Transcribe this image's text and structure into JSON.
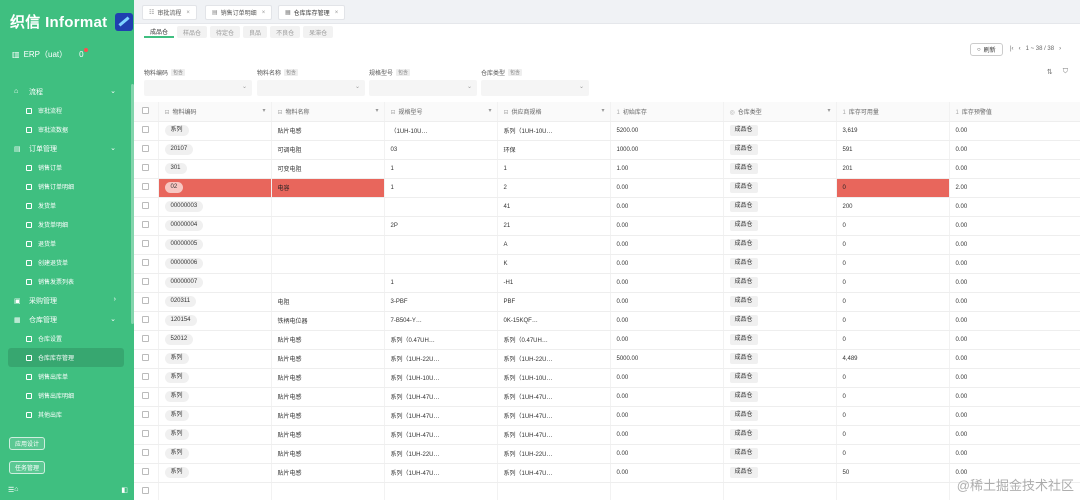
{
  "sidebar": {
    "brand": "织信 Informat",
    "app": "ERP（uat）",
    "notify_count": "0",
    "menu": [
      {
        "type": "group",
        "label": "流程",
        "icon": "⌂",
        "chevron": "⌄"
      },
      {
        "type": "item",
        "label": "审批流程"
      },
      {
        "type": "item",
        "label": "审批流数据"
      },
      {
        "type": "group",
        "label": "订单管理",
        "icon": "▤",
        "chevron": "⌄"
      },
      {
        "type": "item",
        "label": "销售订单"
      },
      {
        "type": "item",
        "label": "销售订单明细"
      },
      {
        "type": "item",
        "label": "发货单"
      },
      {
        "type": "item",
        "label": "发货单明细"
      },
      {
        "type": "item",
        "label": "退货单"
      },
      {
        "type": "item",
        "label": "创建退货单"
      },
      {
        "type": "item",
        "label": "销售发票列表"
      },
      {
        "type": "group",
        "label": "采购管理",
        "icon": "▣",
        "chevron": "›"
      },
      {
        "type": "group",
        "label": "仓库管理",
        "icon": "▦",
        "chevron": "⌄"
      },
      {
        "type": "item",
        "label": "仓库设置"
      },
      {
        "type": "item",
        "label": "仓库库存管理",
        "active": true
      },
      {
        "type": "item",
        "label": "销售出库单"
      },
      {
        "type": "item",
        "label": "销售出库明细"
      },
      {
        "type": "item",
        "label": "其他出库"
      }
    ],
    "btn_app_design": "应用设计",
    "btn_task_mgmt": "任务管理"
  },
  "top_tabs": [
    {
      "label": "审批流程",
      "icon": "☷"
    },
    {
      "label": "销售订单明细",
      "icon": "▤"
    },
    {
      "label": "仓库库存管理",
      "icon": "▦",
      "active": true
    }
  ],
  "sub_tabs": [
    {
      "label": "成品仓",
      "active": true
    },
    {
      "label": "样品仓"
    },
    {
      "label": "待定仓"
    },
    {
      "label": "良品"
    },
    {
      "label": "不良仓"
    },
    {
      "label": "呆滞仓"
    }
  ],
  "toolbar": {
    "refresh": "刷新",
    "pager_text": "1 ~ 38 / 38"
  },
  "filters": [
    {
      "label": "物料编码",
      "tag": "包含"
    },
    {
      "label": "物料名称",
      "tag": "包含"
    },
    {
      "label": "规格型号",
      "tag": "包含"
    },
    {
      "label": "仓库类型",
      "tag": "包含"
    }
  ],
  "columns": [
    "物料编码",
    "物料名称",
    "规格型号",
    "供应商规格",
    "初始库存",
    "仓库类型",
    "库存可用量",
    "库存预警值"
  ],
  "rows": [
    {
      "code": "系列",
      "name": "贴片电感",
      "spec": "（1UH-10U…",
      "supplier": "系列（1UH-10U…",
      "init": "5200.00",
      "type": "成品仓",
      "avail": "3,619",
      "warn": "0.00"
    },
    {
      "code": "20107",
      "name": "可调电阻",
      "spec": "03",
      "supplier": "环保",
      "init": "1000.00",
      "type": "成品仓",
      "avail": "591",
      "warn": "0.00"
    },
    {
      "code": "301",
      "name": "可变电阻",
      "spec": "1",
      "supplier": "1",
      "init": "1.00",
      "type": "成品仓",
      "avail": "201",
      "warn": "0.00"
    },
    {
      "code": "02",
      "name": "电容",
      "spec": "1",
      "supplier": "2",
      "init": "0.00",
      "type": "成品仓",
      "avail": "0",
      "warn": "2.00",
      "highlight": true
    },
    {
      "code": "00000003",
      "name": "",
      "spec": "",
      "supplier": "41",
      "init": "0.00",
      "type": "成品仓",
      "avail": "200",
      "warn": "0.00"
    },
    {
      "code": "00000004",
      "name": "",
      "spec": "2P",
      "supplier": "21",
      "init": "0.00",
      "type": "成品仓",
      "avail": "0",
      "warn": "0.00"
    },
    {
      "code": "00000005",
      "name": "",
      "spec": "",
      "supplier": "A",
      "init": "0.00",
      "type": "成品仓",
      "avail": "0",
      "warn": "0.00"
    },
    {
      "code": "00000006",
      "name": "",
      "spec": "",
      "supplier": "K",
      "init": "0.00",
      "type": "成品仓",
      "avail": "0",
      "warn": "0.00"
    },
    {
      "code": "00000007",
      "name": "",
      "spec": "1",
      "supplier": "-H1",
      "init": "0.00",
      "type": "成品仓",
      "avail": "0",
      "warn": "0.00"
    },
    {
      "code": "020311",
      "name": "电阻",
      "spec": "3-PBF",
      "supplier": "PBF",
      "init": "0.00",
      "type": "成品仓",
      "avail": "0",
      "warn": "0.00"
    },
    {
      "code": "120154",
      "name": "铁柄电位器",
      "spec": "7-B504-Y…",
      "supplier": "0K-15KQF…",
      "init": "0.00",
      "type": "成品仓",
      "avail": "0",
      "warn": "0.00"
    },
    {
      "code": "52012",
      "name": "贴片电感",
      "spec": "系列（0.47UH…",
      "supplier": "系列（0.47UH…",
      "init": "0.00",
      "type": "成品仓",
      "avail": "0",
      "warn": "0.00"
    },
    {
      "code": "系列",
      "name": "贴片电感",
      "spec": "系列（1UH-22U…",
      "supplier": "系列（1UH-22U…",
      "init": "5000.00",
      "type": "成品仓",
      "avail": "4,489",
      "warn": "0.00"
    },
    {
      "code": "系列",
      "name": "贴片电感",
      "spec": "系列（1UH-10U…",
      "supplier": "系列（1UH-10U…",
      "init": "0.00",
      "type": "成品仓",
      "avail": "0",
      "warn": "0.00"
    },
    {
      "code": "系列",
      "name": "贴片电感",
      "spec": "系列（1UH-47U…",
      "supplier": "系列（1UH-47U…",
      "init": "0.00",
      "type": "成品仓",
      "avail": "0",
      "warn": "0.00"
    },
    {
      "code": "系列",
      "name": "贴片电感",
      "spec": "系列（1UH-47U…",
      "supplier": "系列（1UH-47U…",
      "init": "0.00",
      "type": "成品仓",
      "avail": "0",
      "warn": "0.00"
    },
    {
      "code": "系列",
      "name": "贴片电感",
      "spec": "系列（1UH-47U…",
      "supplier": "系列（1UH-47U…",
      "init": "0.00",
      "type": "成品仓",
      "avail": "0",
      "warn": "0.00"
    },
    {
      "code": "系列",
      "name": "贴片电感",
      "spec": "系列（1UH-22U…",
      "supplier": "系列（1UH-22U…",
      "init": "0.00",
      "type": "成品仓",
      "avail": "0",
      "warn": "0.00"
    },
    {
      "code": "系列",
      "name": "贴片电感",
      "spec": "系列（1UH-47U…",
      "supplier": "系列（1UH-47U…",
      "init": "0.00",
      "type": "成品仓",
      "avail": "50",
      "warn": "0.00"
    },
    {
      "code": "",
      "name": "",
      "spec": "",
      "supplier": "",
      "init": "",
      "type": "",
      "avail": "",
      "warn": ""
    }
  ],
  "watermark": "@稀土掘金技术社区",
  "colors": {
    "sidebar": "#3fbf80",
    "highlight": "#e8665c"
  }
}
